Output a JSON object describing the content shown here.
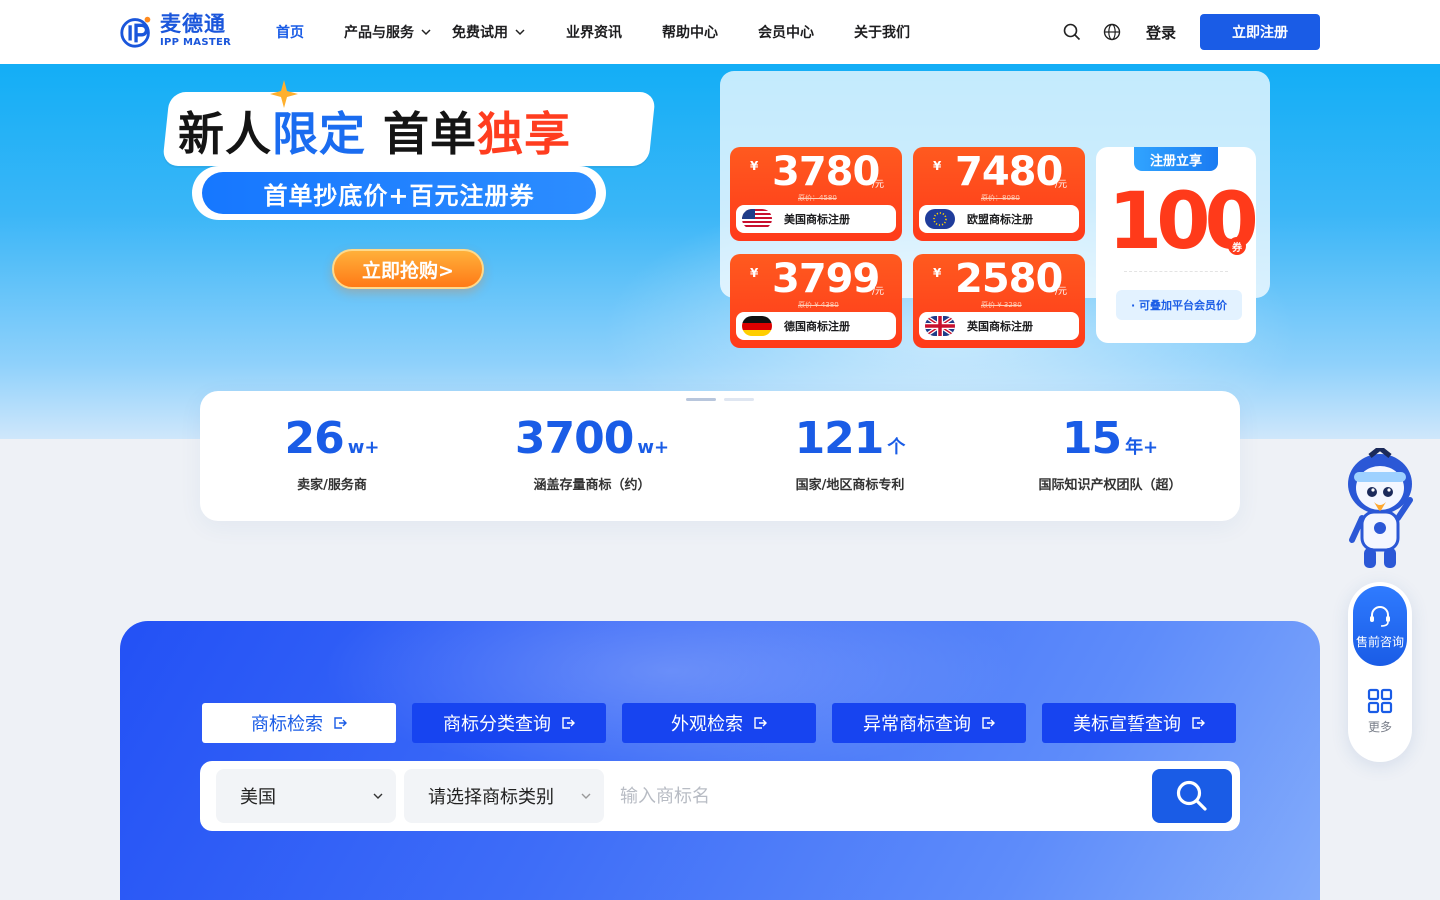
{
  "header": {
    "logo_cn": "麦德通",
    "logo_en": "IPP MASTER",
    "nav": [
      "首页",
      "产品与服务",
      "免费试用",
      "业界资讯",
      "帮助中心",
      "会员中心",
      "关于我们"
    ],
    "login": "登录",
    "register": "立即注册"
  },
  "hero": {
    "title_part1": "新人",
    "title_part2": "限定",
    "title_part3": " 首单",
    "title_part4": "独享",
    "subtitle": "首单抄底价+百元注册券",
    "cta": "立即抢购>"
  },
  "prices": [
    {
      "yen": "¥",
      "amount": "3780",
      "unit": "/元",
      "original": "原价：4580",
      "name": "美国商标注册"
    },
    {
      "yen": "¥",
      "amount": "7480",
      "unit": "/元",
      "original": "原价：8080",
      "name": "欧盟商标注册"
    },
    {
      "yen": "¥",
      "amount": "3799",
      "unit": "/元",
      "original": "原价 ¥ 4380",
      "name": "德国商标注册"
    },
    {
      "yen": "¥",
      "amount": "2580",
      "unit": "/元",
      "original": "原价 ¥ 3280",
      "name": "英国商标注册"
    }
  ],
  "coupon": {
    "tag": "注册立享",
    "amount": "100",
    "suffix": "券",
    "note": "· 可叠加平台会员价"
  },
  "stats": [
    {
      "num": "26",
      "suffix": "w+",
      "label": "卖家/服务商"
    },
    {
      "num": "3700",
      "suffix": "w+",
      "label": "涵盖存量商标（约）"
    },
    {
      "num": "121",
      "suffix": "个",
      "label": "国家/地区商标专利"
    },
    {
      "num": "15",
      "suffix": "年+",
      "label": "国际知识产权团队（超）"
    }
  ],
  "search": {
    "tabs": [
      "商标检索",
      "商标分类查询",
      "外观检索",
      "异常商标查询",
      "美标宣誓查询"
    ],
    "country": "美国",
    "category": "请选择商标类别",
    "placeholder": "输入商标名"
  },
  "side": {
    "consult": "售前咨询",
    "more": "更多"
  },
  "colors": {
    "brand": "#1a5ce6",
    "accent_red": "#ff3a1a",
    "cta_orange": "#ff7a16"
  }
}
